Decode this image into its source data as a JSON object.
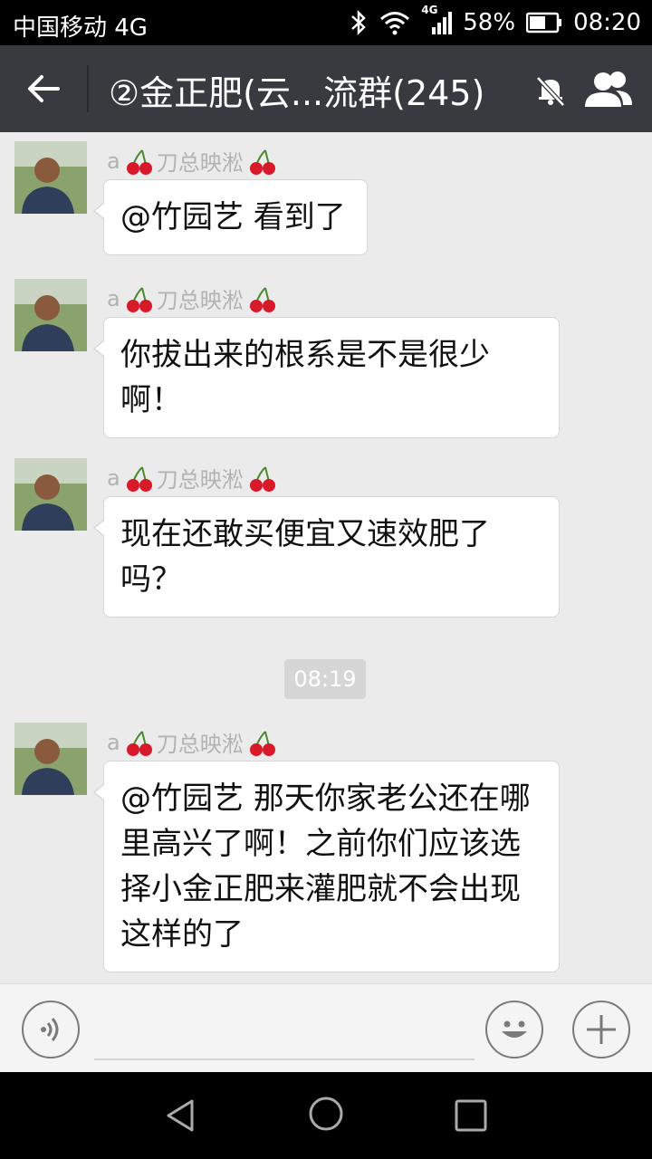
{
  "status_bar": {
    "carrier": "中国移动 4G",
    "network_small": "4G",
    "battery": "58%",
    "time": "08:20"
  },
  "header": {
    "title": "②金正肥(云...流群(245)",
    "icons": [
      "back-arrow-icon",
      "mute-bell-icon",
      "group-members-icon"
    ]
  },
  "messages": [
    {
      "sender_prefix": "a",
      "sender_name": "刀总映淞",
      "text": "@竹园艺 看到了"
    },
    {
      "sender_prefix": "a",
      "sender_name": "刀总映淞",
      "text": "你拔出来的根系是不是很少啊！"
    },
    {
      "sender_prefix": "a",
      "sender_name": "刀总映淞",
      "text": "现在还敢买便宜又速效肥了吗？"
    },
    {
      "sender_prefix": "a",
      "sender_name": "刀总映淞",
      "text": "@竹园艺 那天你家老公还在哪里高兴了啊！之前你们应该选择小金正肥来灌肥就不会出现这样的了"
    }
  ],
  "timestamp": "08:19",
  "input_bar": {
    "placeholder": ""
  },
  "colors": {
    "header_bg": "#393a3f",
    "chat_bg": "#ebebeb",
    "bubble_bg": "#ffffff",
    "sender_gray": "#b3b3b3"
  }
}
